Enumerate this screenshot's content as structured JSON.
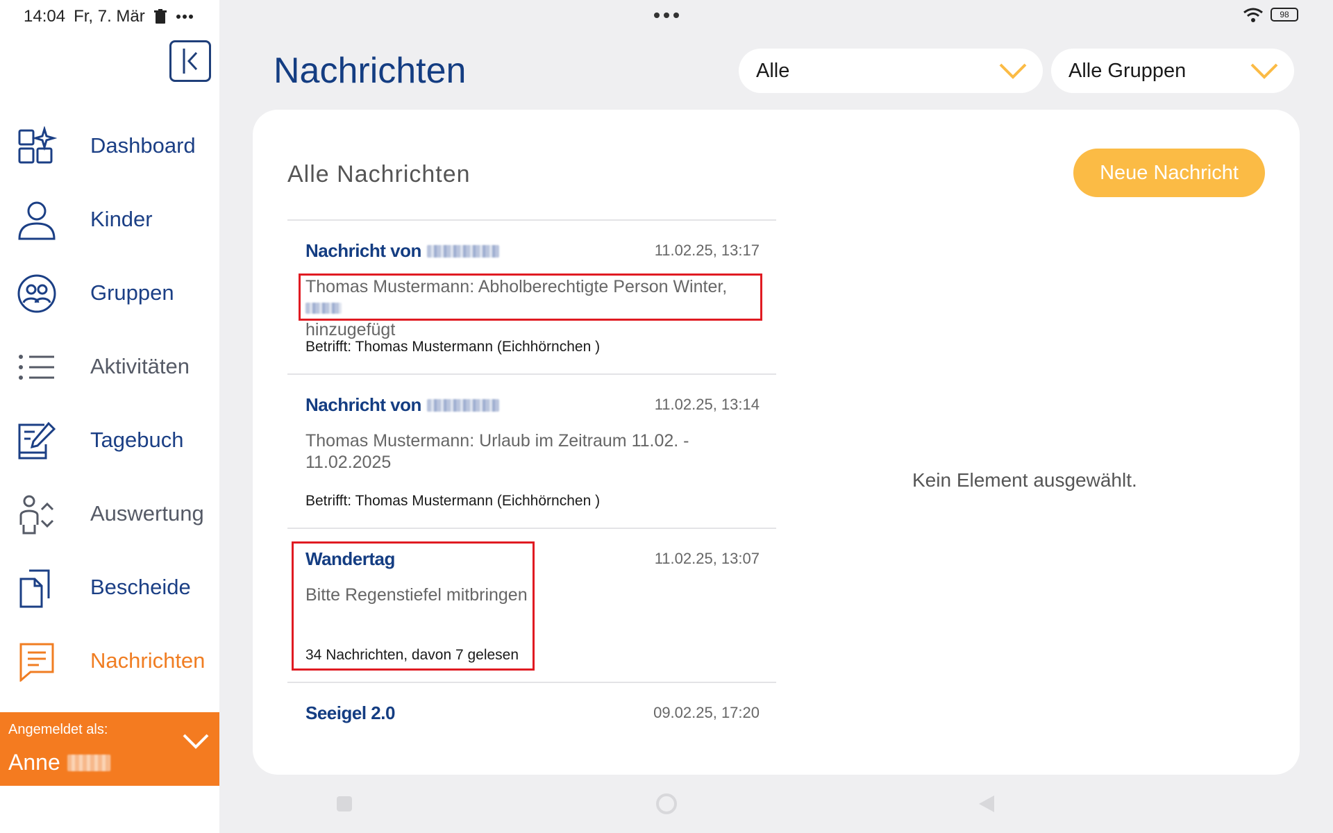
{
  "status_bar": {
    "time": "14:04",
    "date": "Fr, 7. Mär",
    "battery": "98"
  },
  "sidebar": {
    "items": [
      {
        "label": "Dashboard",
        "icon": "dashboard-icon"
      },
      {
        "label": "Kinder",
        "icon": "person-icon"
      },
      {
        "label": "Gruppen",
        "icon": "group-icon"
      },
      {
        "label": "Aktivitäten",
        "icon": "list-icon"
      },
      {
        "label": "Tagebuch",
        "icon": "diary-icon"
      },
      {
        "label": "Auswertung",
        "icon": "evaluation-icon"
      },
      {
        "label": "Bescheide",
        "icon": "documents-icon"
      },
      {
        "label": "Nachrichten",
        "icon": "message-icon"
      }
    ],
    "active": "Nachrichten",
    "user": {
      "caption": "Angemeldet als:",
      "name": "Anne"
    }
  },
  "header": {
    "title": "Nachrichten",
    "filter_type": "Alle",
    "filter_group": "Alle Gruppen"
  },
  "card": {
    "title": "Alle Nachrichten",
    "new_button": "Neue Nachricht",
    "empty_state": "Kein Element ausgewählt."
  },
  "messages": [
    {
      "title": "Nachricht von",
      "date": "11.02.25, 13:17",
      "body1": "Thomas Mustermann: Abholberechtigte Person Winter,",
      "body2": "hinzugefügt",
      "meta": "Betrifft: Thomas Mustermann (Eichhörnchen )"
    },
    {
      "title": "Nachricht von",
      "date": "11.02.25, 13:14",
      "body1": "Thomas Mustermann: Urlaub im Zeitraum 11.02. -",
      "body2": "11.02.2025",
      "meta": "Betrifft: Thomas Mustermann (Eichhörnchen )"
    },
    {
      "title": "Wandertag",
      "date": "11.02.25, 13:07",
      "body1": "Bitte Regenstiefel mitbringen",
      "meta": "34 Nachrichten, davon 7 gelesen"
    },
    {
      "title": "Seeigel 2.0",
      "date": "09.02.25, 17:20"
    }
  ],
  "colors": {
    "brand_blue": "#143d82",
    "accent_orange": "#f47b20",
    "button_yellow": "#fbbb45",
    "highlight_red": "#e01b22"
  }
}
